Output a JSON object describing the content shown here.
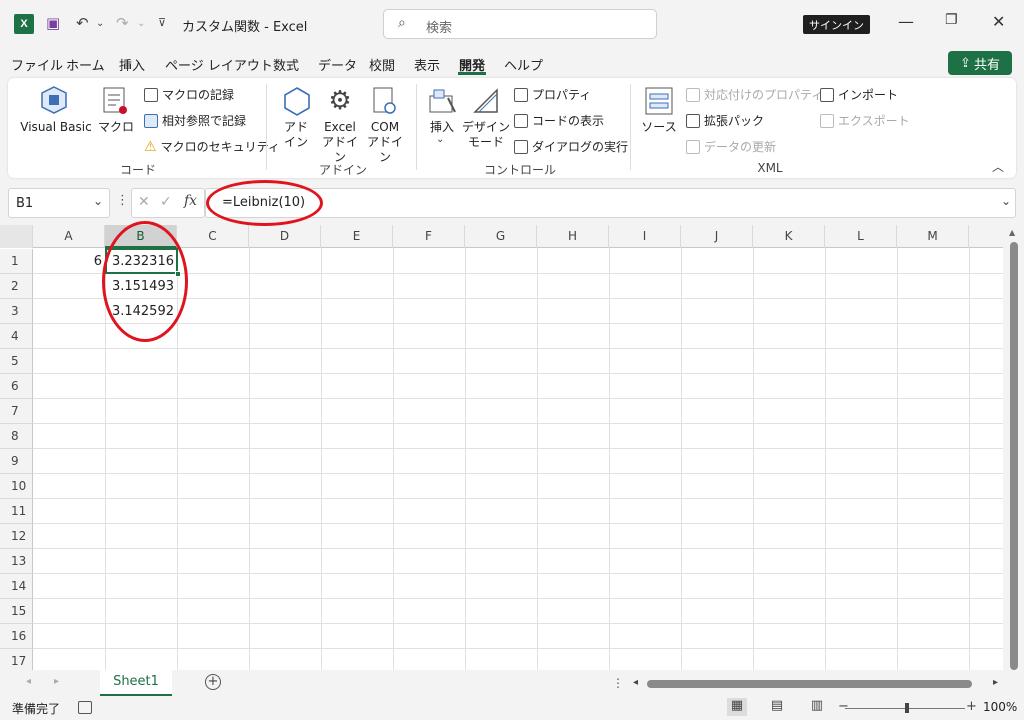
{
  "titlebar": {
    "logo": "X",
    "doc_title": "カスタム関数  -  Excel",
    "search_placeholder": "検索",
    "signin": "サインイン"
  },
  "menu": {
    "items": [
      "ファイル",
      "ホーム",
      "挿入",
      "ページ レイアウト",
      "数式",
      "データ",
      "校閲",
      "表示",
      "開発",
      "ヘルプ"
    ],
    "active": "開発",
    "share": "共有"
  },
  "ribbon": {
    "code": {
      "visual_basic": "Visual Basic",
      "macro": "マクロ",
      "record_macro": "マクロの記録",
      "relative_ref": "相対参照で記録",
      "macro_security": "マクロのセキュリティ",
      "group": "コード"
    },
    "addins": {
      "addin": "アド\nイン",
      "excel_addin": "Excel\nアドイン",
      "com_addin": "COM\nアドイン",
      "group": "アドイン"
    },
    "controls": {
      "insert": "挿入",
      "design_mode": "デザイン\nモード",
      "properties": "プロパティ",
      "view_code": "コードの表示",
      "run_dialog": "ダイアログの実行",
      "group": "コントロール"
    },
    "xml": {
      "source": "ソース",
      "map_properties": "対応付けのプロパティ",
      "expansion_packs": "拡張パック",
      "refresh_data": "データの更新",
      "import": "インポート",
      "export": "エクスポート",
      "group": "XML"
    }
  },
  "formula_bar": {
    "name_box": "B1",
    "fx": "fx",
    "formula": "=Leibniz(10)"
  },
  "grid": {
    "columns": [
      "A",
      "B",
      "C",
      "D",
      "E",
      "F",
      "G",
      "H",
      "I",
      "J",
      "K",
      "L",
      "M"
    ],
    "rows": [
      "1",
      "2",
      "3",
      "4",
      "5",
      "6",
      "7",
      "8",
      "9",
      "10",
      "11",
      "12",
      "13",
      "14",
      "15",
      "16",
      "17"
    ],
    "selected_column": "B",
    "cells": {
      "A1": "6",
      "B1": "3.232316",
      "B2": "3.151493",
      "B3": "3.142592"
    }
  },
  "sheet_tabs": {
    "active": "Sheet1"
  },
  "status": {
    "ready": "準備完了",
    "zoom": "100%"
  },
  "colors": {
    "accent": "#1e7145",
    "annotation": "#e0141e"
  }
}
